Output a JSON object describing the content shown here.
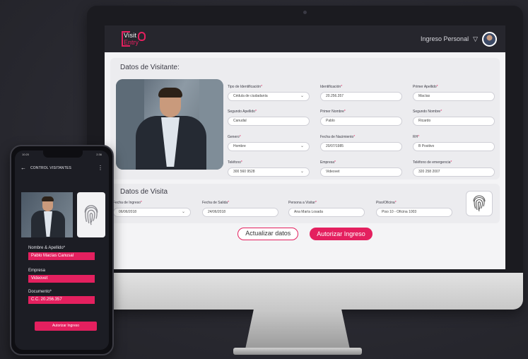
{
  "desktop": {
    "header": {
      "logo_top": "Visit",
      "logo_bottom": "Entry",
      "user_menu_label": "Ingreso Personal",
      "chevron": "▽"
    },
    "visitor_section": {
      "title": "Datos de Visitante:",
      "fields": [
        {
          "label": "Tipo de Identificación",
          "value": "Cédula de ciudadanía",
          "dropdown": true
        },
        {
          "label": "Identificación",
          "value": "20.256.357",
          "dropdown": false
        },
        {
          "label": "Primer Apellido",
          "value": "Macías",
          "dropdown": false
        },
        {
          "label": "Segundo Apellido",
          "value": "Canudal",
          "dropdown": false
        },
        {
          "label": "Primer Nombre",
          "value": "Pablo",
          "dropdown": false
        },
        {
          "label": "Segundo Nombre",
          "value": "Ricardo",
          "dropdown": false
        },
        {
          "label": "Genero",
          "value": "Hombre",
          "dropdown": true
        },
        {
          "label": "Fecha de Nacimiento",
          "value": "20/07/1985",
          "dropdown": false
        },
        {
          "label": "RH",
          "value": "B Positivo",
          "dropdown": false
        },
        {
          "label": "Teléfono",
          "value": "300 560 9528",
          "dropdown": true
        },
        {
          "label": "Empresa",
          "value": "Videovet",
          "dropdown": false
        },
        {
          "label": "Teléfono de emergencia",
          "value": "320 258 2007",
          "dropdown": false
        }
      ]
    },
    "visit_section": {
      "title": "Datos de Visita",
      "fields": [
        {
          "label": "Fecha de Ingreso",
          "value": "06/06/2018",
          "dropdown": true
        },
        {
          "label": "Fecha de Salida",
          "value": "24/06/2018",
          "dropdown": false
        },
        {
          "label": "Persona a Visitar",
          "value": "Ana María Losada",
          "dropdown": false
        },
        {
          "label": "Piso/Oficina",
          "value": "Piso 10 - Oficina 1003",
          "dropdown": false
        }
      ]
    },
    "actions": {
      "update_label": "Actualizar datos",
      "authorize_label": "Autorizar Ingreso"
    },
    "required_mark": "*"
  },
  "phone": {
    "status": {
      "left": "10:20",
      "right": "2:36"
    },
    "header": {
      "back": "←",
      "title": "CONTROL VISITANTES",
      "menu": "⋮"
    },
    "fields": [
      {
        "label": "Nombre & Apellido*",
        "value": "Pablo Macías Canusal"
      },
      {
        "label": "Empresa",
        "value": "Videovet"
      },
      {
        "label": "Documento*",
        "value": "C.C. 20.256.357"
      }
    ],
    "button_label": "Autorizar Ingreso"
  },
  "colors": {
    "accent": "#e4205f",
    "bezel": "#1b1b20",
    "topbar": "#26262d"
  },
  "icons": [
    "fingerprint-icon",
    "chevron-down-icon",
    "back-arrow-icon",
    "kebab-menu-icon",
    "user-avatar"
  ]
}
